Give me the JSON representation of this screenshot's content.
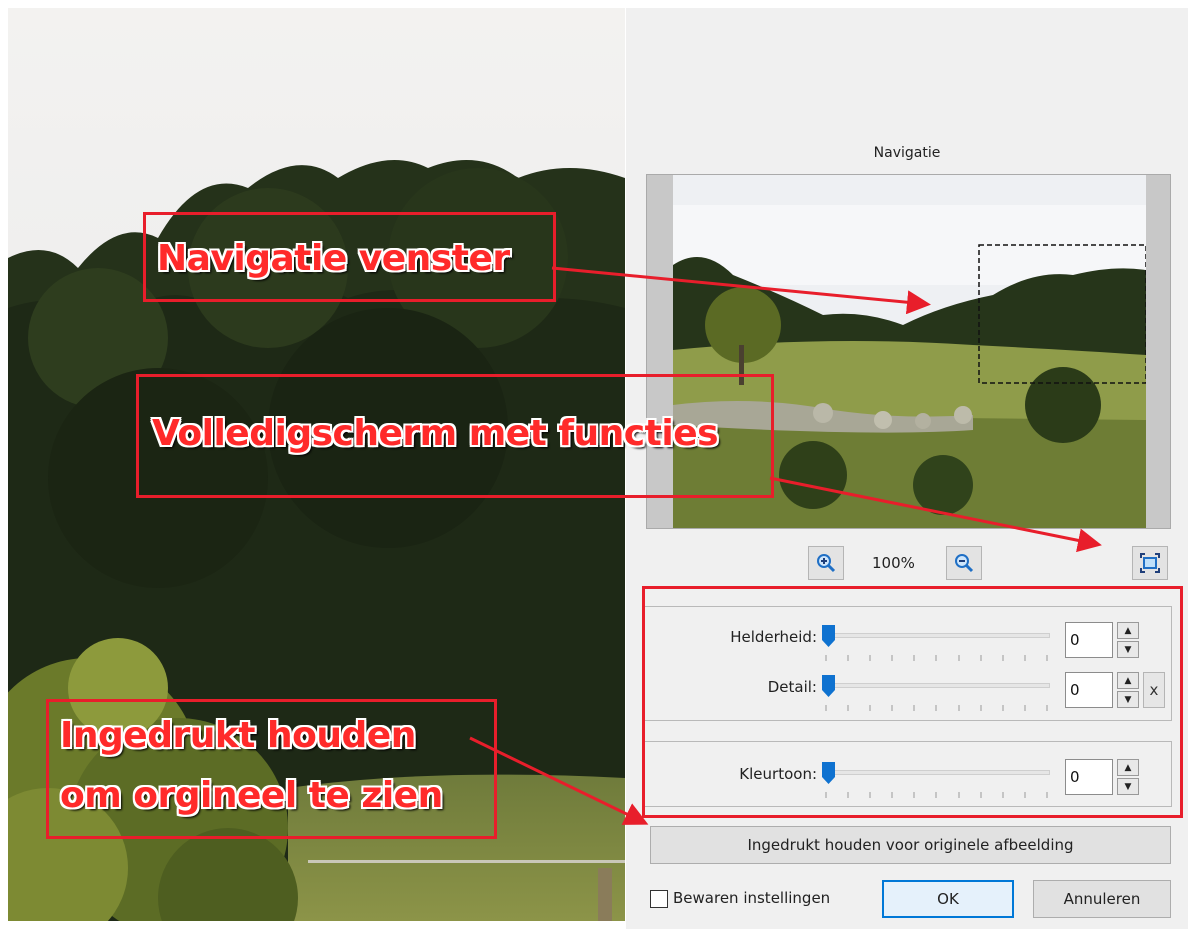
{
  "navigation": {
    "title": "Navigatie",
    "zoom_level": "100%"
  },
  "adjustments": {
    "brightness": {
      "label": "Helderheid:",
      "value": "0"
    },
    "detail": {
      "label": "Detail:",
      "value": "0",
      "reset_label": "x"
    },
    "hue": {
      "label": "Kleurtoon:",
      "value": "0"
    }
  },
  "buttons": {
    "hold_original": "Ingedrukt houden voor originele afbeelding",
    "ok": "OK",
    "cancel": "Annuleren"
  },
  "save_settings": {
    "label": "Bewaren instellingen",
    "checked": false
  },
  "annotations": {
    "nav_window": "Navigatie venster",
    "fullscreen": "Volledigscherm met functies",
    "hold_line1": "Ingedrukt houden",
    "hold_line2": "om orgineel te zien"
  },
  "icons": {
    "zoom_in": "zoom-in-icon",
    "zoom_out": "zoom-out-icon",
    "fullscreen": "fullscreen-icon"
  },
  "colors": {
    "annotation_red": "#e81e2b",
    "accent_blue": "#0078d7",
    "panel_bg": "#f0f0f0"
  }
}
